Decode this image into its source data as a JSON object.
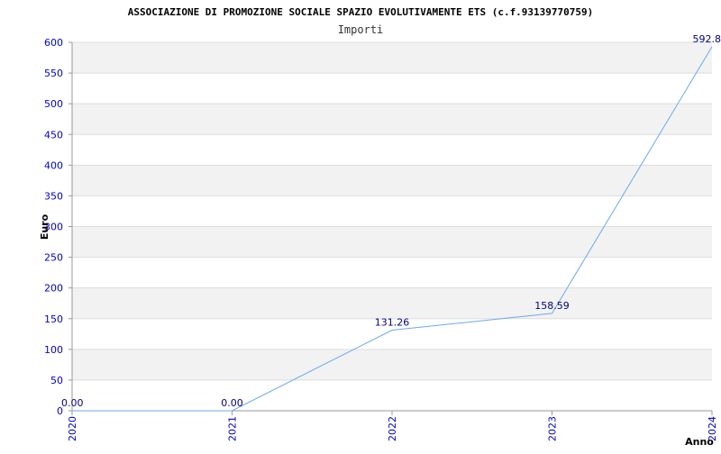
{
  "chart_data": {
    "type": "line",
    "title": "ASSOCIAZIONE DI PROMOZIONE SOCIALE SPAZIO EVOLUTIVAMENTE ETS (c.f.93139770759)",
    "subtitle": "Importi",
    "xlabel": "Anno",
    "ylabel": "Euro",
    "categories": [
      "2020",
      "2021",
      "2022",
      "2023",
      "2024"
    ],
    "ylim": [
      0,
      600
    ],
    "yticks": [
      0,
      50,
      100,
      150,
      200,
      250,
      300,
      350,
      400,
      450,
      500,
      550,
      600
    ],
    "series": [
      {
        "values": [
          0.0,
          0.0,
          131.26,
          158.59,
          592.8
        ],
        "labels": [
          "0.00",
          "0.00",
          "131.26",
          "158.59",
          "592.8"
        ]
      }
    ],
    "grid": "horizontal alternating bands",
    "colors": {
      "line": "#6aaaee",
      "band": "#f2f2f2",
      "grid": "#dddddd",
      "tick_text": "#0000cc",
      "value_text": "#000080"
    }
  }
}
